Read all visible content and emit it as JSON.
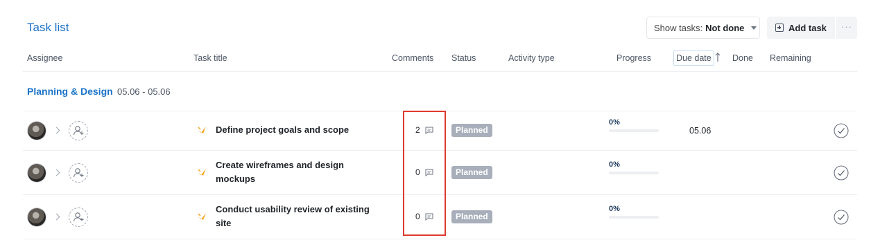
{
  "header": {
    "title": "Task list",
    "show_tasks_label": "Show tasks:",
    "show_tasks_value": "Not done",
    "add_task_label": "Add task",
    "more_label": "···"
  },
  "columns": {
    "assignee": "Assignee",
    "task_title": "Task title",
    "comments": "Comments",
    "status": "Status",
    "activity_type": "Activity type",
    "progress": "Progress",
    "due_date": "Due date",
    "done": "Done",
    "remaining": "Remaining"
  },
  "group": {
    "name": "Planning & Design",
    "dates": "05.06 - 05.06"
  },
  "rows": [
    {
      "title": "Define project goals and scope",
      "comments": "2",
      "status": "Planned",
      "progress_label": "0%",
      "progress": 0,
      "due": "05.06"
    },
    {
      "title": "Create wireframes and design mockups",
      "comments": "0",
      "status": "Planned",
      "progress_label": "0%",
      "progress": 0,
      "due": ""
    },
    {
      "title": "Conduct usability review of existing site",
      "comments": "0",
      "status": "Planned",
      "progress_label": "0%",
      "progress": 0,
      "due": ""
    }
  ],
  "colors": {
    "accent": "#1a73c8",
    "status_planned": "#a8afbb",
    "highlight": "#e03a2f"
  },
  "icons": {
    "add_task": "plus-square-icon",
    "sort": "arrow-up-icon",
    "expand": "chevron-right-icon",
    "add_assignee": "user-plus-icon",
    "activity": "spark-icon",
    "comment": "speech-bubble-icon",
    "done": "check-circle-icon"
  }
}
